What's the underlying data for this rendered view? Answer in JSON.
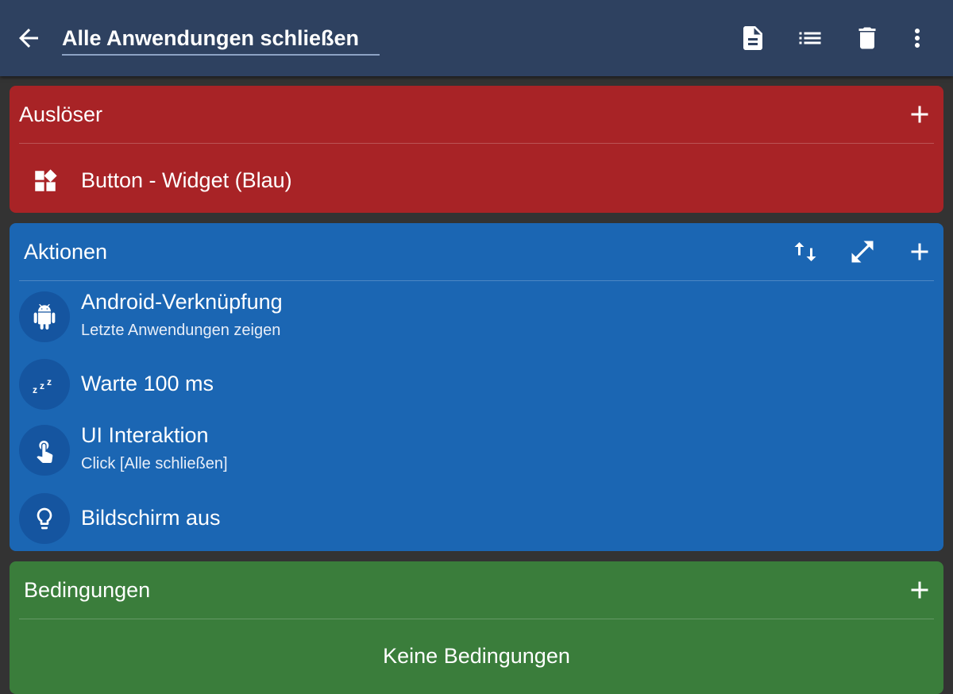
{
  "header": {
    "title": "Alle Anwendungen schließen",
    "icons": [
      "back-arrow-icon",
      "document-icon",
      "list-icon",
      "trash-icon",
      "more-vert-icon"
    ]
  },
  "trigger": {
    "title": "Auslöser",
    "items": [
      {
        "icon": "widget-icon",
        "title": "Button - Widget (Blau)"
      }
    ]
  },
  "actions": {
    "title": "Aktionen",
    "items": [
      {
        "icon": "android-icon",
        "title": "Android-Verknüpfung",
        "subtitle": "Letzte Anwendungen zeigen"
      },
      {
        "icon": "sleep-zzz-icon",
        "title": "Warte 100 ms"
      },
      {
        "icon": "touch-icon",
        "title": "UI Interaktion",
        "subtitle": "Click [Alle schließen]"
      },
      {
        "icon": "lightbulb-icon",
        "title": "Bildschirm aus"
      }
    ]
  },
  "conditions": {
    "title": "Bedingungen",
    "empty_text": "Keine Bedingungen"
  },
  "colors": {
    "topbar": "#2e4160",
    "background": "#333333",
    "trigger": "#a82326",
    "actions": "#1b66b3",
    "action_icon_circle": "#1555a0",
    "conditions": "#3a7d3b"
  }
}
